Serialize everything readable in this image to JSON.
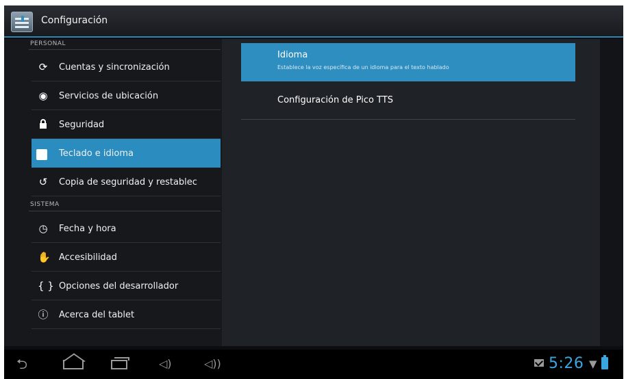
{
  "action_bar": {
    "title": "Configuración",
    "app_icon": "settings-icon"
  },
  "left_panel": {
    "personal_header": "PERSONAL",
    "personal_items": [
      {
        "label": "Cuentas y sincronización",
        "icon": "sync-icon"
      },
      {
        "label": "Servicios de ubicación",
        "icon": "location-icon"
      },
      {
        "label": "Seguridad",
        "icon": "lock-icon"
      },
      {
        "label": "Teclado e idioma",
        "icon": "keyboard-language-icon",
        "selected": true
      },
      {
        "label": "Copia de seguridad y restablec",
        "icon": "backup-restore-icon"
      }
    ],
    "system_header": "SISTEMA",
    "system_items": [
      {
        "label": "Fecha y hora",
        "icon": "clock-icon"
      },
      {
        "label": "Accesibilidad",
        "icon": "hand-icon"
      },
      {
        "label": "Opciones del desarrollador",
        "icon": "braces-icon"
      },
      {
        "label": "Acerca del tablet",
        "icon": "info-icon"
      }
    ]
  },
  "right_panel": {
    "items": [
      {
        "title": "Idioma",
        "summary": "Establece la voz específica de un idioma para el texto hablado",
        "selected": true
      },
      {
        "title": "Configuración de Pico TTS"
      }
    ]
  },
  "nav_bar": {
    "buttons": [
      "back-icon",
      "home-icon",
      "recent-apps-icon",
      "volume-down-icon",
      "volume-up-icon"
    ],
    "time": "5:26",
    "status_icons": [
      "mail-icon",
      "wifi-icon",
      "battery-icon"
    ]
  },
  "colors": {
    "accent": "#2b8cbf",
    "clock": "#3aa6df",
    "background": "#1f2226"
  }
}
